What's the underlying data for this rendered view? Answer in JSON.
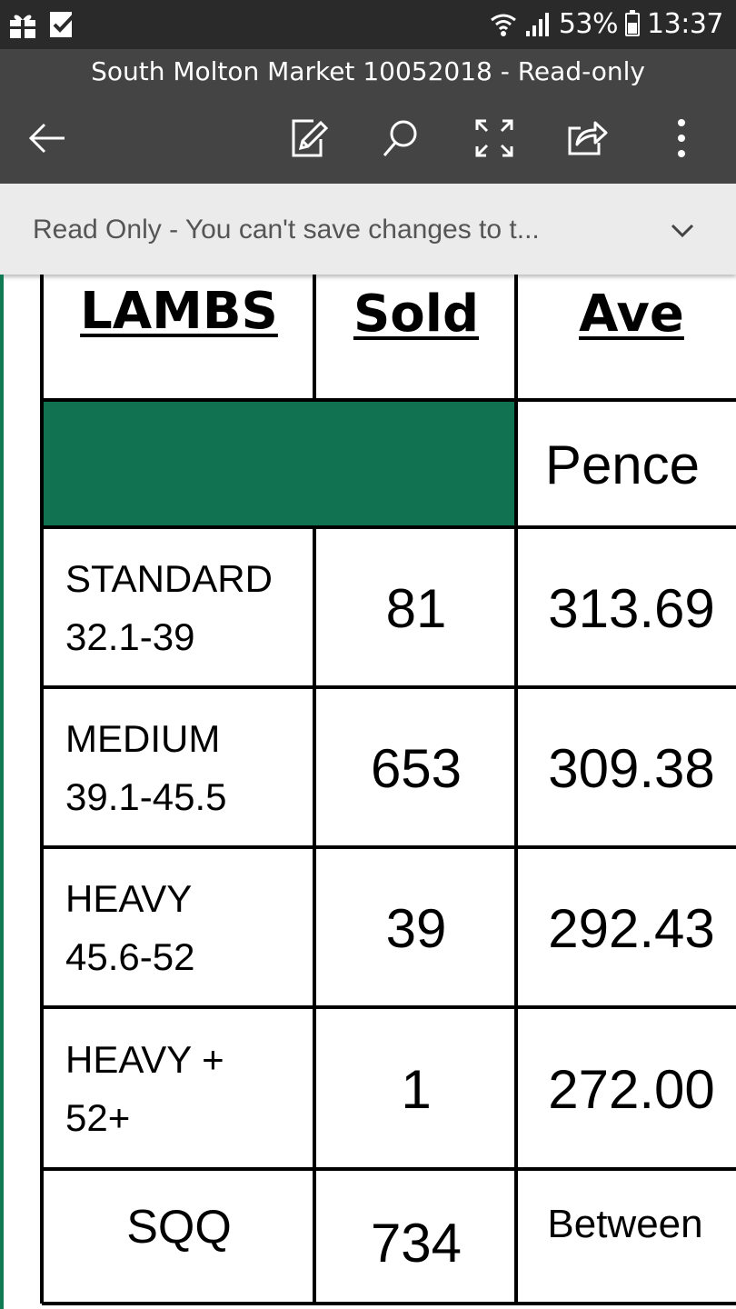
{
  "status_bar": {
    "battery": "53%",
    "time": "13:37"
  },
  "app_bar": {
    "title": "South Molton Market 10052018 - Read-only"
  },
  "banner": {
    "message": "Read Only - You can't save changes to t..."
  },
  "table": {
    "headers": [
      "LAMBS",
      "Sold",
      "Ave"
    ],
    "unit_row": {
      "ave_unit": "Pence"
    },
    "rows": [
      {
        "category": "STANDARD",
        "range": "32.1-39",
        "sold": "81",
        "ave": "313.69"
      },
      {
        "category": "MEDIUM",
        "range": "39.1-45.5",
        "sold": "653",
        "ave": "309.38"
      },
      {
        "category": "HEAVY",
        "range": "45.6-52",
        "sold": "39",
        "ave": "292.43"
      },
      {
        "category": "HEAVY +",
        "range": "52+",
        "sold": "1",
        "ave": "272.00"
      }
    ],
    "summary": {
      "label": "SQQ",
      "sold": "734",
      "ave": "Between"
    }
  },
  "colors": {
    "accent_green": "#107250",
    "appbar": "#444444",
    "statusbar": "#2a2a2a"
  }
}
